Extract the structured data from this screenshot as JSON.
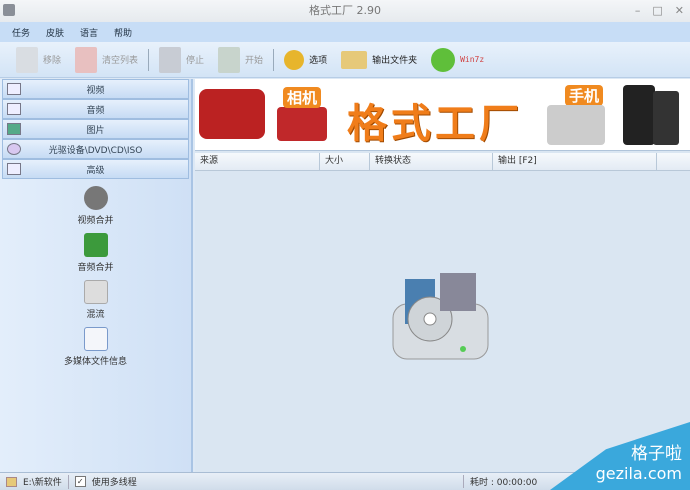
{
  "window": {
    "title": "格式工厂 2.90",
    "controls": [
      "–",
      "□",
      "✕"
    ]
  },
  "menu": [
    "任务",
    "皮肤",
    "语言",
    "帮助"
  ],
  "toolbar": [
    {
      "label": "移除",
      "enabled": false,
      "icon": "remove-icon",
      "color": "#d9dde2"
    },
    {
      "label": "清空列表",
      "enabled": false,
      "icon": "clear-list-icon",
      "color": "#e8c0c0"
    },
    {
      "label": "停止",
      "enabled": false,
      "icon": "stop-icon",
      "color": "#c8ccd4"
    },
    {
      "label": "开始",
      "enabled": false,
      "icon": "start-icon",
      "color": "#c8d4cc"
    },
    {
      "label": "选项",
      "enabled": true,
      "icon": "options-icon",
      "color": "#e7b52c"
    },
    {
      "label": "输出文件夹",
      "enabled": true,
      "icon": "output-folder-icon",
      "color": "#e6c979"
    },
    {
      "label": "Win7z",
      "enabled": true,
      "icon": "globe-icon",
      "color": "#5fbf3a"
    }
  ],
  "categories": [
    "视频",
    "音频",
    "图片",
    "光驱设备\\DVD\\CD\\ISO",
    "高级"
  ],
  "tools": [
    {
      "label": "视频合并",
      "color": "#777"
    },
    {
      "label": "音频合并",
      "color": "#3c9a3c"
    },
    {
      "label": "混流",
      "color": "#bbb"
    },
    {
      "label": "多媒体文件信息",
      "color": "#7a9acb"
    }
  ],
  "banner": {
    "title": "格式工厂",
    "camera": "相机",
    "phone": "手机"
  },
  "table": {
    "columns": [
      "来源",
      "大小",
      "转换状态",
      "输出 [F2]"
    ]
  },
  "status": {
    "path": "E:\\新软件",
    "multithread": "使用多线程",
    "elapsed": "耗时 : 00:00:00"
  },
  "watermark": {
    "cn": "格子啦",
    "url": "gezila.com"
  }
}
